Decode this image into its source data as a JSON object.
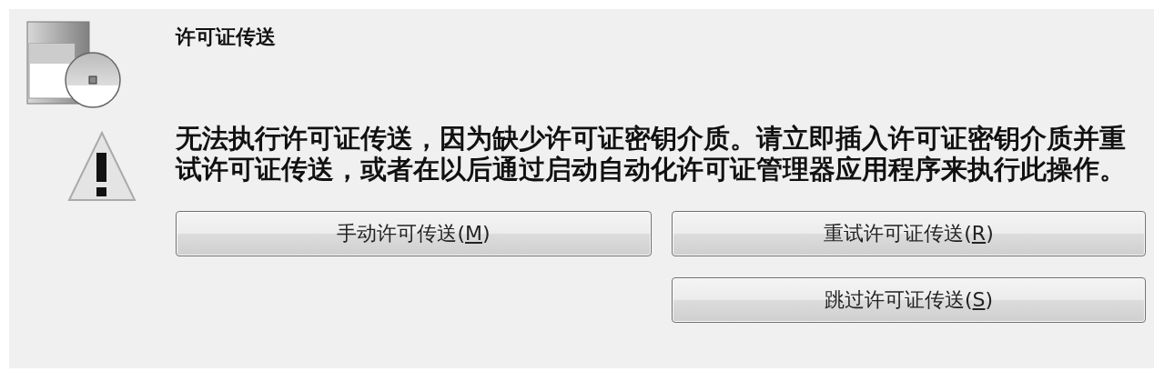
{
  "dialog": {
    "title": "许可证传送",
    "message": "无法执行许可证传送，因为缺少许可证密钥介质。请立即插入许可证密钥介质并重试许可证传送，或者在以后通过启动自动化许可证管理器应用程序来执行此操作。",
    "buttons": [
      {
        "label_before": "手动许可传送(",
        "access_key": "M",
        "label_after": ")"
      },
      {
        "label_before": "重试许可证传送(",
        "access_key": "R",
        "label_after": ")"
      },
      {
        "label_before": "跳过许可证传送(",
        "access_key": "S",
        "label_after": ")"
      }
    ]
  }
}
